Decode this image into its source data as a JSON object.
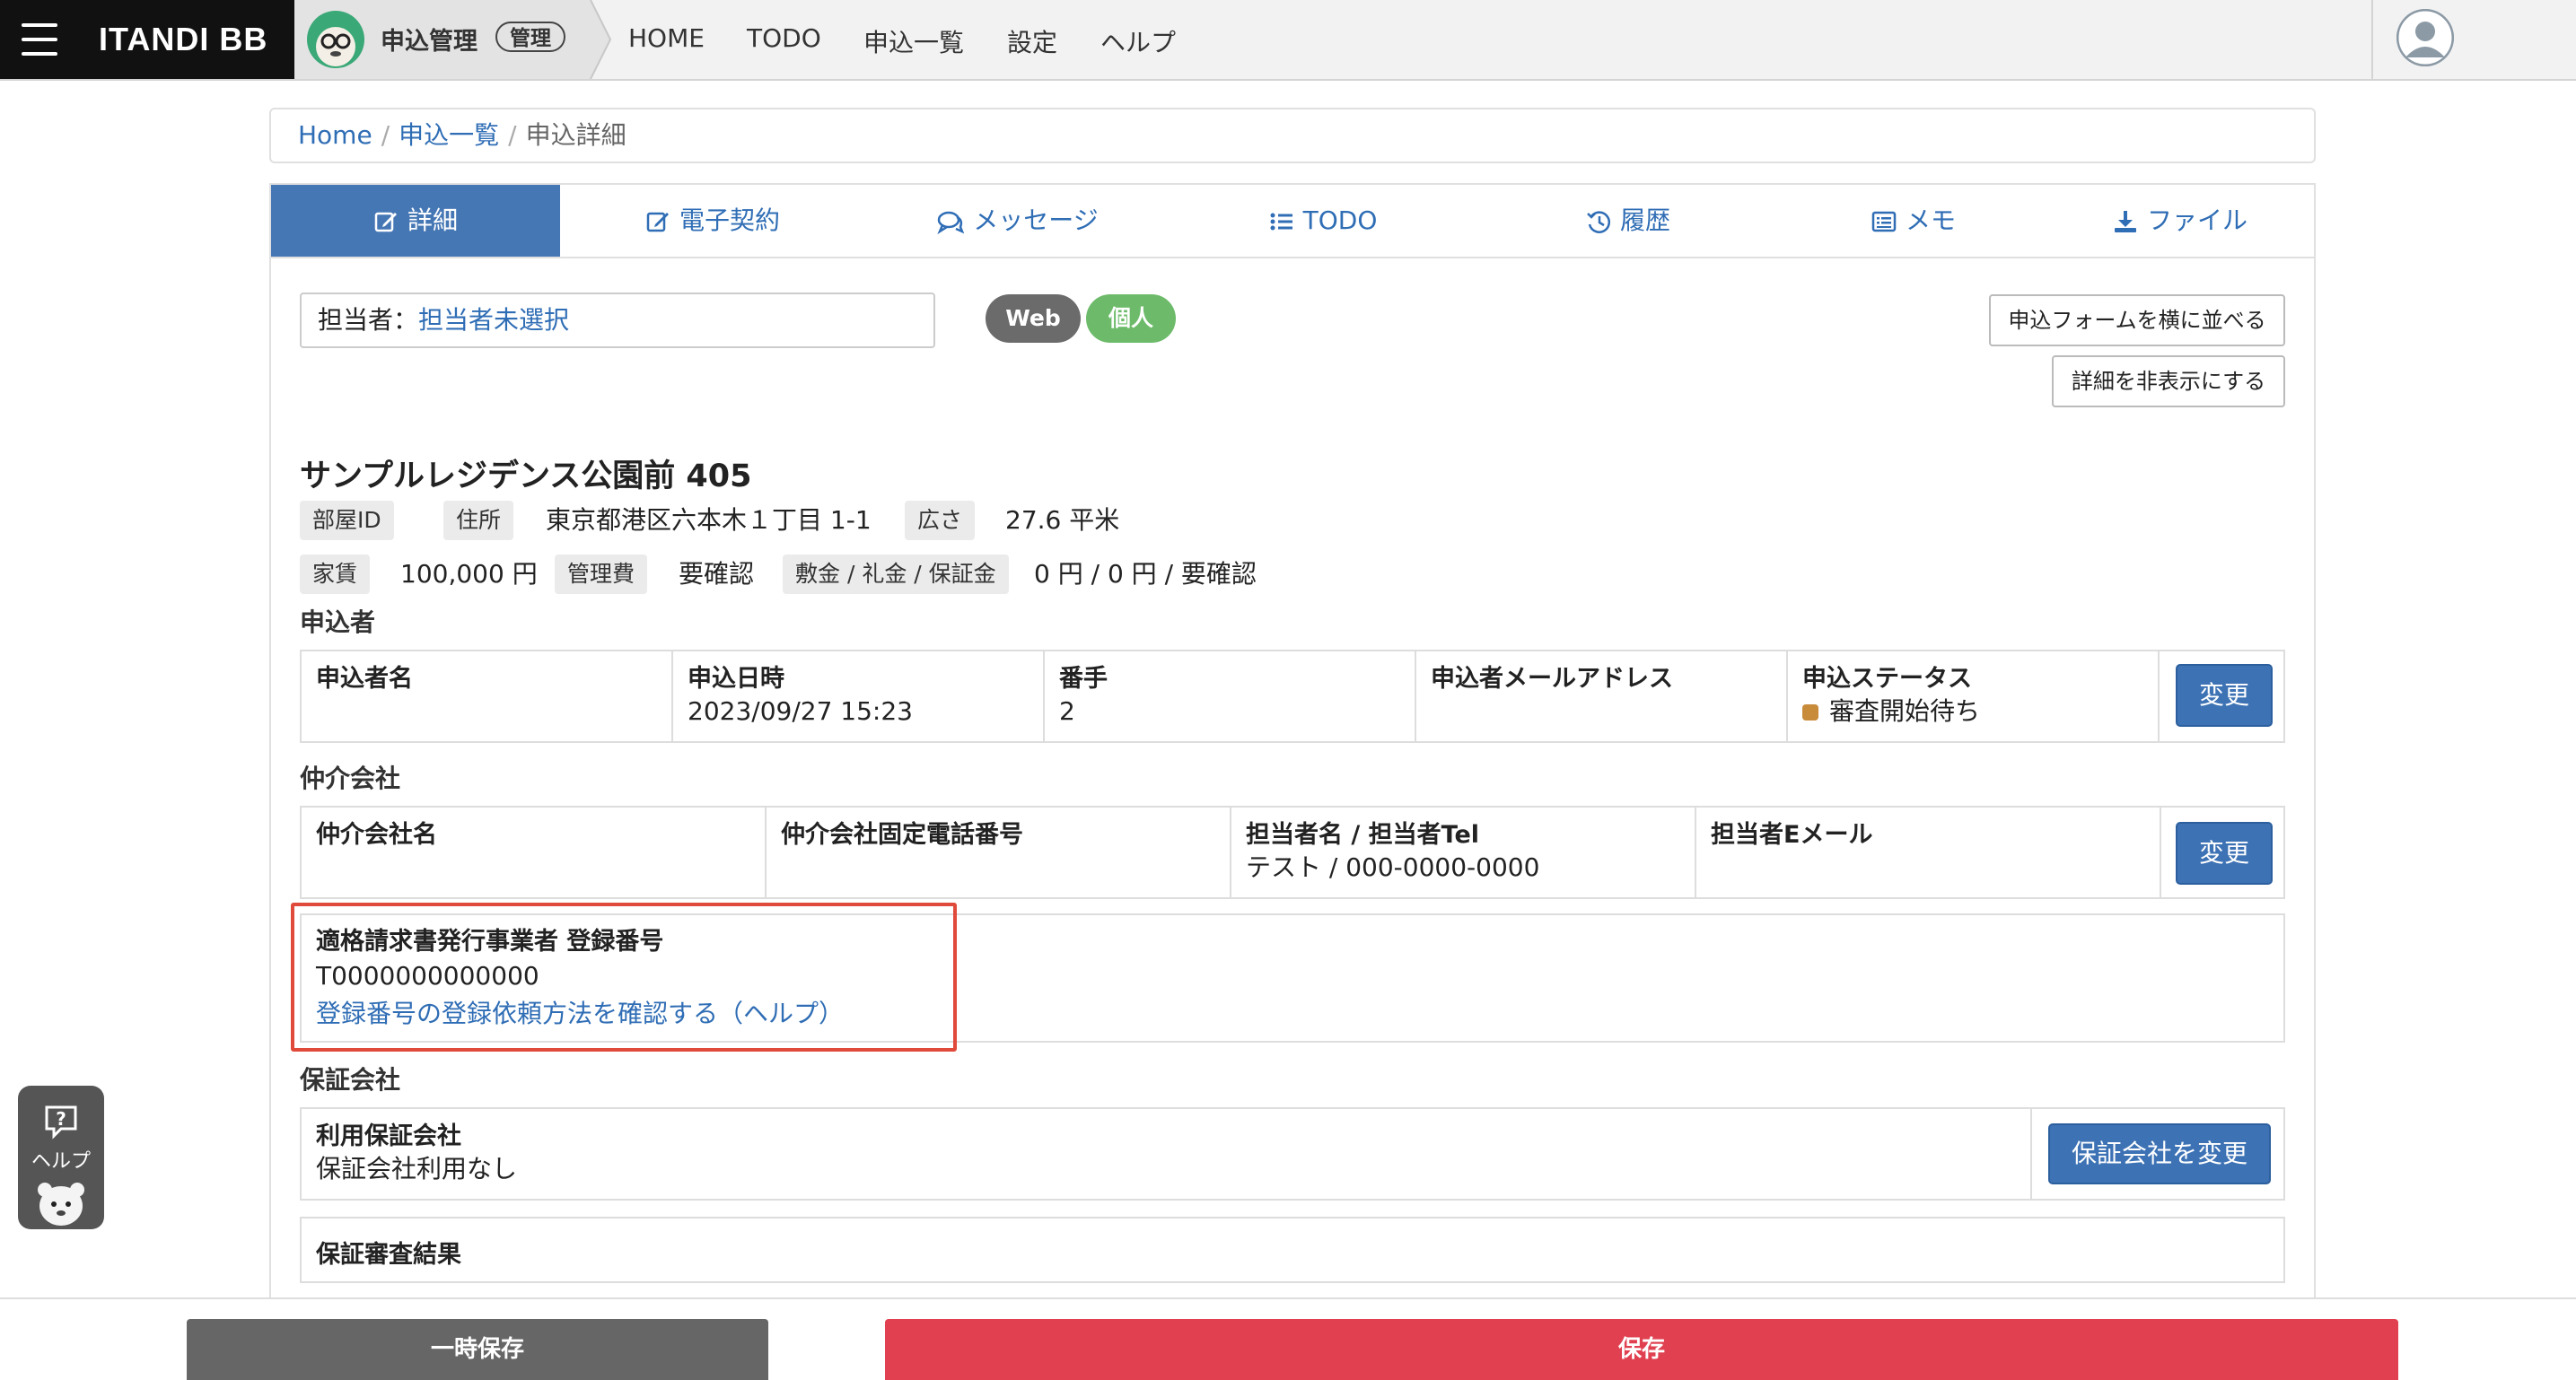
{
  "header": {
    "brand": "ITANDI BB",
    "app_title": "申込管理",
    "app_badge": "管理",
    "nav": [
      "HOME",
      "TODO",
      "申込一覧",
      "設定",
      "ヘルプ"
    ]
  },
  "breadcrumb": {
    "home": "Home",
    "list": "申込一覧",
    "current": "申込詳細"
  },
  "tabs": [
    "詳細",
    "電子契約",
    "メッセージ",
    "TODO",
    "履歴",
    "メモ",
    "ファイル"
  ],
  "assignee": {
    "label": "担当者：",
    "value": "担当者未選択"
  },
  "pills": {
    "web": "Web",
    "personal": "個人"
  },
  "buttons": {
    "side_by_side": "申込フォームを横に並べる",
    "hide_details": "詳細を非表示にする",
    "change": "変更",
    "change_guarantor": "保証会社を変更",
    "temp_save": "一時保存",
    "save": "保存"
  },
  "property": {
    "title": "サンプルレジデンス公園前 405",
    "room_id_label": "部屋ID",
    "address_label": "住所",
    "address": "東京都港区六本木１丁目 1-1",
    "area_label": "広さ",
    "area": "27.6 平米",
    "rent_label": "家賃",
    "rent": "100,000 円",
    "fee_label": "管理費",
    "fee": "要確認",
    "deposit_label": "敷金 / 礼金 / 保証金",
    "deposit": "0 円 / 0 円 / 要確認"
  },
  "applicant": {
    "section": "申込者",
    "name_h": "申込者名",
    "name_v": "",
    "date_h": "申込日時",
    "date_v": "2023/09/27 15:23",
    "order_h": "番手",
    "order_v": "2",
    "email_h": "申込者メールアドレス",
    "email_v": "",
    "status_h": "申込ステータス",
    "status_v": "審査開始待ち",
    "status_color": "#c88b3a"
  },
  "broker": {
    "section": "仲介会社",
    "name_h": "仲介会社名",
    "name_v": "",
    "phone_h": "仲介会社固定電話番号",
    "phone_v": "",
    "contact_h": "担当者名 / 担当者Tel",
    "contact_v": "テスト / 000-0000-0000",
    "email_h": "担当者Eメール",
    "email_v": ""
  },
  "invoice": {
    "heading": "適格請求書発行事業者 登録番号",
    "number": "T0000000000000",
    "help_link": "登録番号の登録依頼方法を確認する（ヘルプ）"
  },
  "guarantor": {
    "section": "保証会社",
    "company_h": "利用保証会社",
    "company_v": "保証会社利用なし",
    "result_h": "保証審査結果"
  },
  "help_widget": {
    "label": "ヘルプ"
  },
  "colors": {
    "tab_active": "#4677b5",
    "primary_button": "#3d72b4",
    "save_button": "#e0404f",
    "temp_save_button": "#666666",
    "pill_web": "#6b6b6b",
    "pill_personal": "#6dbb6a",
    "highlight_border": "#e04a3a"
  }
}
